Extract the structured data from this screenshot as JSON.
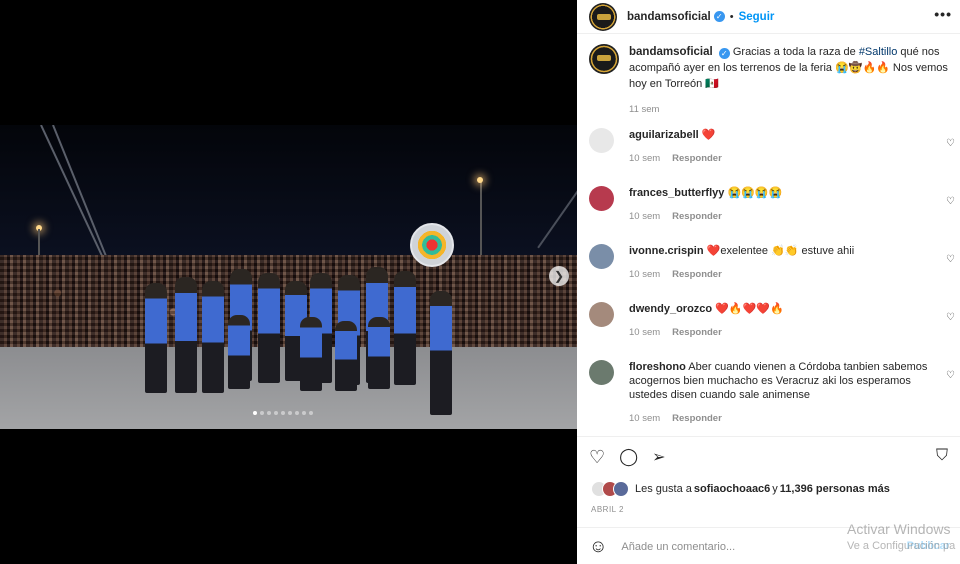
{
  "post": {
    "username": "bandamsoficial",
    "follow_label": "Seguir",
    "separator": "•",
    "more_label": "•••",
    "caption_pre": "Gracias a toda la raza de ",
    "caption_hashtag": "#Saltillo",
    "caption_post": " qué nos acompañó ayer en los terrenos de la feria 😭🤠🔥🔥 Nos vemos hoy en Torreón 🇲🇽",
    "caption_time": "11 sem"
  },
  "media": {
    "carousel_count": 9,
    "carousel_active": 1,
    "next_icon": "chevron-right-icon"
  },
  "comments": [
    {
      "user": "aguilarizabell",
      "text": "❤️",
      "time": "10 sem",
      "reply": "Responder",
      "avatar_color": "#e8e8e8"
    },
    {
      "user": "frances_butterflyy",
      "text": "😭😭😭😭",
      "time": "10 sem",
      "reply": "Responder",
      "avatar_color": "#b73a4e"
    },
    {
      "user": "ivonne.crispin",
      "text": "❤️exelentee 👏👏 estuve ahii",
      "time": "10 sem",
      "reply": "Responder",
      "avatar_color": "#7a8ea8"
    },
    {
      "user": "dwendy_orozco",
      "text": "❤️🔥❤️❤️🔥",
      "time": "10 sem",
      "reply": "Responder",
      "avatar_color": "#a48a7c"
    },
    {
      "user": "floreshono",
      "text": "Aber cuando vienen a Córdoba tanbien sabemos acogernos bien muchacho es Veracruz aki los esperamos ustedes disen cuando sale animense",
      "time": "10 sem",
      "reply": "Responder",
      "avatar_color": "#6b7a6e"
    }
  ],
  "likes": {
    "prefix": "Les gusta a ",
    "user": "sofiaochoaac6",
    "mid": " y ",
    "count": "11,396 personas más"
  },
  "date": "ABRIL 2",
  "add_comment": {
    "placeholder": "Añade un comentario...",
    "publish": "Publicar"
  },
  "windows": {
    "line1": "Activar Windows",
    "line2": "Ve a Configuración pa"
  },
  "colors": {
    "accent": "#0095f6",
    "verified": "#3897f0",
    "link": "#00376b",
    "muted": "#8e8e8e"
  }
}
